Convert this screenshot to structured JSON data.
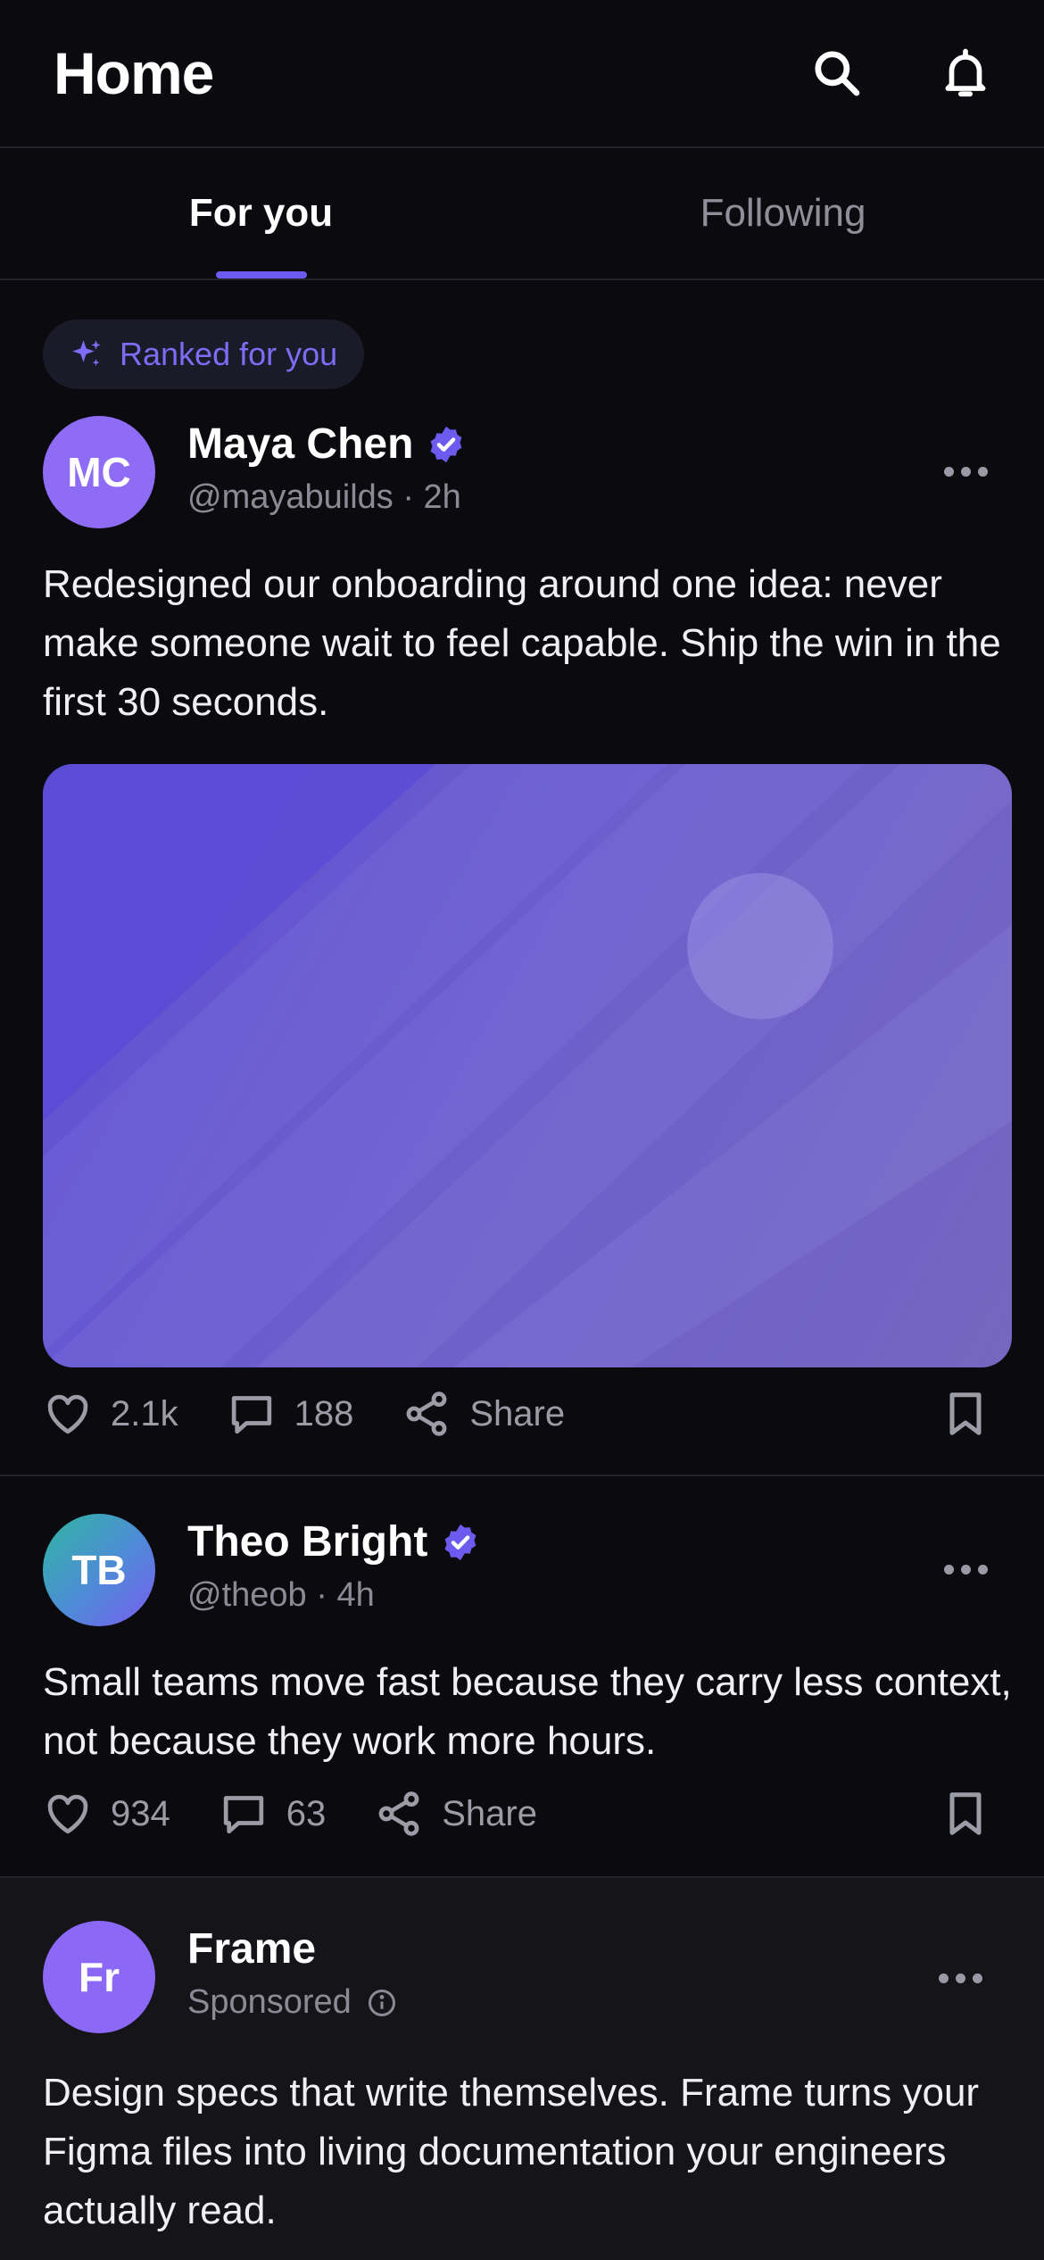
{
  "header": {
    "title": "Home"
  },
  "tabs": [
    {
      "label": "For you",
      "active": true
    },
    {
      "label": "Following",
      "active": false
    }
  ],
  "ranked_pill": {
    "label": "Ranked for you"
  },
  "posts": [
    {
      "initials": "MC",
      "name": "Maya Chen",
      "verified": true,
      "handle_time": "@mayabuilds · 2h",
      "text": "Redesigned our onboarding around one idea: never make someone wait to feel capable. Ship the win in the first 30 seconds.",
      "has_media": true,
      "likes": "2.1k",
      "comments": "188",
      "share_label": "Share"
    },
    {
      "initials": "TB",
      "name": "Theo Bright",
      "verified": true,
      "handle_time": "@theob · 4h",
      "text": "Small teams move fast because they carry less context, not because they work more hours.",
      "has_media": false,
      "likes": "934",
      "comments": "63",
      "share_label": "Share"
    },
    {
      "initials": "Fr",
      "name": "Frame",
      "verified": false,
      "sponsored_label": "Sponsored",
      "text": "Design specs that write themselves. Frame turns your Figma files into living documentation your engineers actually read."
    }
  ],
  "colors": {
    "accent": "#6d5bf0",
    "background": "#0b0b0f",
    "sponsored_background": "#141419",
    "muted_text": "#8b8b96"
  },
  "icons": [
    "search-icon",
    "bell-icon",
    "sparkle-icon",
    "verified-icon",
    "more-icon",
    "heart-icon",
    "comment-icon",
    "share-icon",
    "bookmark-icon",
    "info-icon"
  ]
}
